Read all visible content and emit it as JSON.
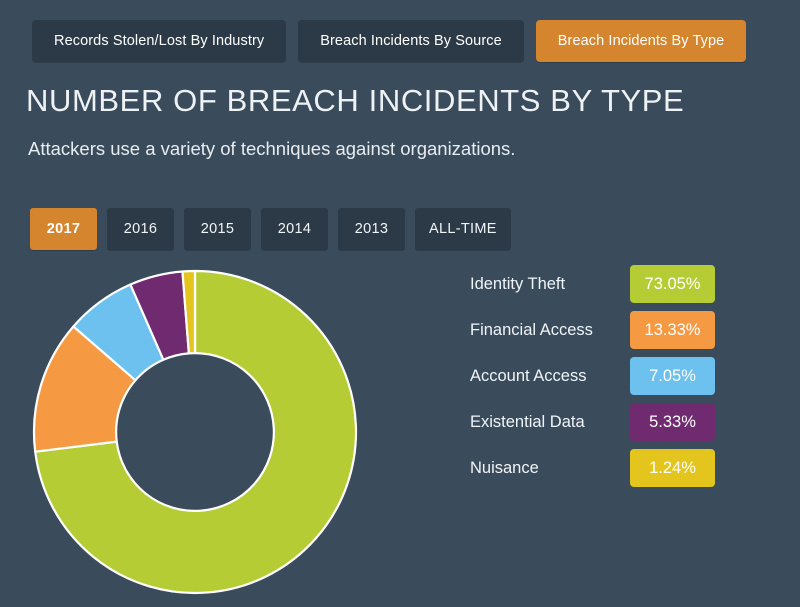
{
  "tabs": [
    {
      "label": "Records Stolen/Lost By Industry",
      "active": false
    },
    {
      "label": "Breach Incidents By Source",
      "active": false
    },
    {
      "label": "Breach Incidents By Type",
      "active": true
    }
  ],
  "header": {
    "title": "NUMBER OF BREACH INCIDENTS BY TYPE",
    "subtitle": "Attackers use a variety of techniques against organizations."
  },
  "year_filter": {
    "options": [
      "2017",
      "2016",
      "2015",
      "2014",
      "2013",
      "ALL-TIME"
    ],
    "selected": "2017"
  },
  "theme": {
    "background": "#3a4b5c",
    "tab_background": "#2c3a47",
    "accent": "#d4852e",
    "text": "#f0f4f7"
  },
  "chart_data": {
    "type": "pie",
    "title": "NUMBER OF BREACH INCIDENTS BY TYPE",
    "subtitle": "Attackers use a variety of techniques against organizations.",
    "donut": true,
    "inner_radius_ratio": 0.49,
    "start_angle_deg": 0,
    "direction": "clockwise",
    "legend_position": "right",
    "categories": [
      "Identity Theft",
      "Financial Access",
      "Account Access",
      "Existential Data",
      "Nuisance"
    ],
    "values": [
      73.05,
      13.33,
      7.05,
      5.33,
      1.24
    ],
    "labels": [
      "73.05%",
      "13.33%",
      "7.05%",
      "5.33%",
      "1.24%"
    ],
    "colors": [
      "#b6cc34",
      "#f59a42",
      "#6dc1ee",
      "#702a70",
      "#e4c51e"
    ],
    "slices": [
      {
        "name": "Identity Theft",
        "value": 73.05,
        "label": "73.05%",
        "color": "#b6cc34"
      },
      {
        "name": "Financial Access",
        "value": 13.33,
        "label": "13.33%",
        "color": "#f59a42"
      },
      {
        "name": "Account Access",
        "value": 7.05,
        "label": "7.05%",
        "color": "#6dc1ee"
      },
      {
        "name": "Existential Data",
        "value": 5.33,
        "label": "5.33%",
        "color": "#702a70"
      },
      {
        "name": "Nuisance",
        "value": 1.24,
        "label": "1.24%",
        "color": "#e4c51e"
      }
    ]
  }
}
